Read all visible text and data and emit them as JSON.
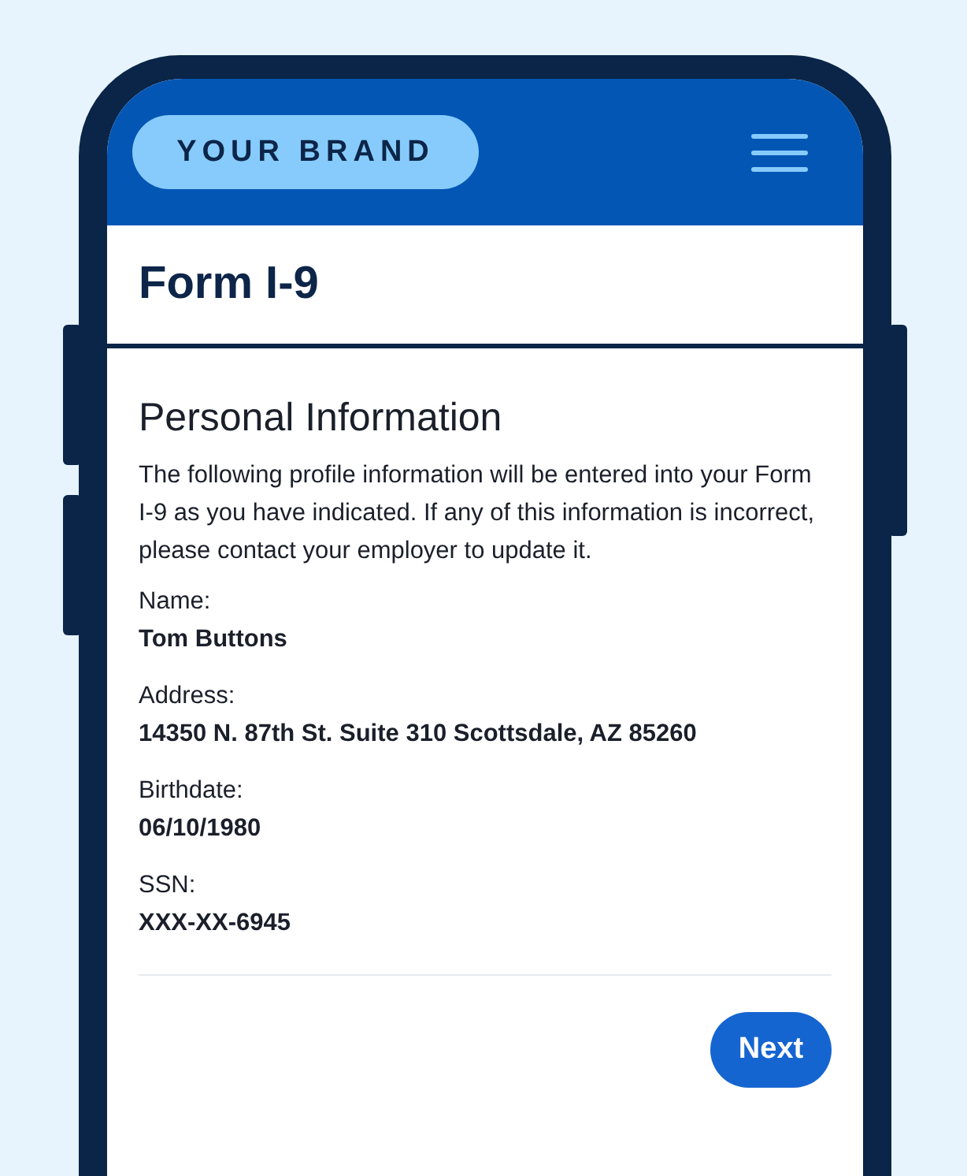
{
  "header": {
    "brand": "YOUR BRAND"
  },
  "page_title": "Form I-9",
  "section": {
    "title": "Personal Information",
    "intro": "The following profile information will be entered into your Form I-9 as you have indicated. If any of this information is incorrect, please contact your employer to update it."
  },
  "fields": [
    {
      "label": "Name:",
      "value": "Tom Buttons"
    },
    {
      "label": "Address:",
      "value": "14350 N. 87th St. Suite 310 Scottsdale, AZ 85260"
    },
    {
      "label": "Birthdate:",
      "value": "06/10/1980"
    },
    {
      "label": "SSN:",
      "value": "XXX-XX-6945"
    }
  ],
  "buttons": [
    "Next"
  ]
}
